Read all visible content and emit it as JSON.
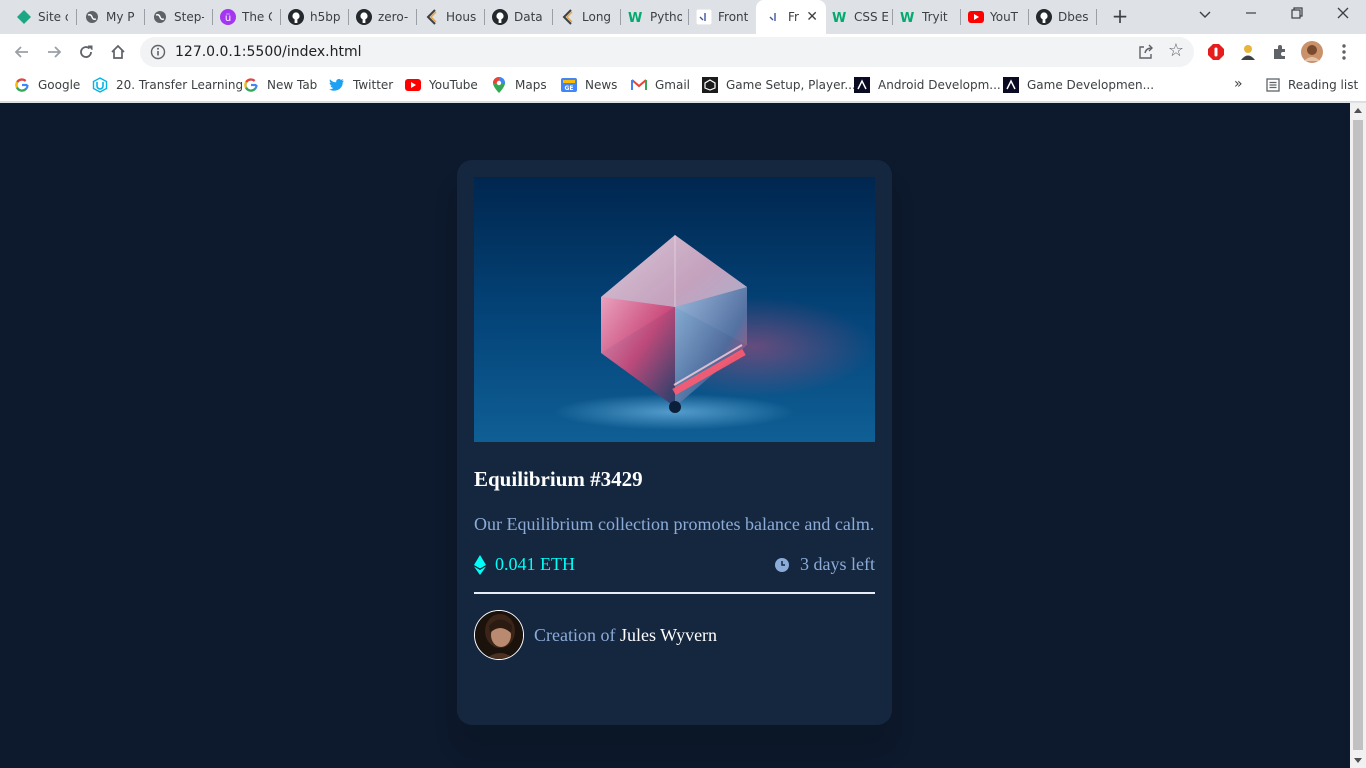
{
  "tabs": [
    {
      "title": "Site c",
      "icon": "diamond-icon"
    },
    {
      "title": "My P",
      "icon": "globe-icon"
    },
    {
      "title": "Step-",
      "icon": "globe-icon"
    },
    {
      "title": "The C",
      "icon": "udemy-icon"
    },
    {
      "title": "h5bp",
      "icon": "github-icon"
    },
    {
      "title": "zero-",
      "icon": "github-icon"
    },
    {
      "title": "Hous",
      "icon": "kaggle-chevron-icon"
    },
    {
      "title": "Data",
      "icon": "github-icon"
    },
    {
      "title": "Long",
      "icon": "kaggle-chevron-icon"
    },
    {
      "title": "Pytho",
      "icon": "w3schools-icon"
    },
    {
      "title": "Front",
      "icon": "frontend-mentor-icon"
    },
    {
      "title": "Fr",
      "icon": "frontend-mentor-icon",
      "active": true
    },
    {
      "title": "CSS E",
      "icon": "w3schools-icon"
    },
    {
      "title": "Tryit",
      "icon": "w3schools-icon"
    },
    {
      "title": "YouT",
      "icon": "youtube-icon"
    },
    {
      "title": "Dbes",
      "icon": "github-icon"
    }
  ],
  "toolbar": {
    "url": "127.0.0.1:5500/index.html"
  },
  "bookmarks": [
    {
      "label": "Google",
      "icon": "google-icon"
    },
    {
      "label": "20. Transfer Learning",
      "icon": "udacity-icon"
    },
    {
      "label": "New Tab",
      "icon": "google-icon"
    },
    {
      "label": "Twitter",
      "icon": "twitter-icon"
    },
    {
      "label": "YouTube",
      "icon": "youtube-icon"
    },
    {
      "label": "Maps",
      "icon": "maps-icon"
    },
    {
      "label": "News",
      "icon": "news-icon"
    },
    {
      "label": "Gmail",
      "icon": "gmail-icon"
    },
    {
      "label": "Game Setup, Player...",
      "icon": "unity-icon"
    },
    {
      "label": "Android Developm...",
      "icon": "android-dev-icon"
    },
    {
      "label": "Game Developmen...",
      "icon": "android-dev-icon"
    }
  ],
  "reading_list": "Reading list",
  "card": {
    "title": "Equilibrium #3429",
    "description": "Our Equilibrium collection promotes balance and calm.",
    "price": "0.041 ETH",
    "time_left": "3 days left",
    "creator_prefix": "Creation of",
    "creator_name": "Jules Wyvern"
  },
  "colors": {
    "page_bg": "#0d192c",
    "card_bg": "#15263f",
    "cyan": "#00fff8",
    "soft_blue": "#8bacd9",
    "white": "#ffffff"
  }
}
